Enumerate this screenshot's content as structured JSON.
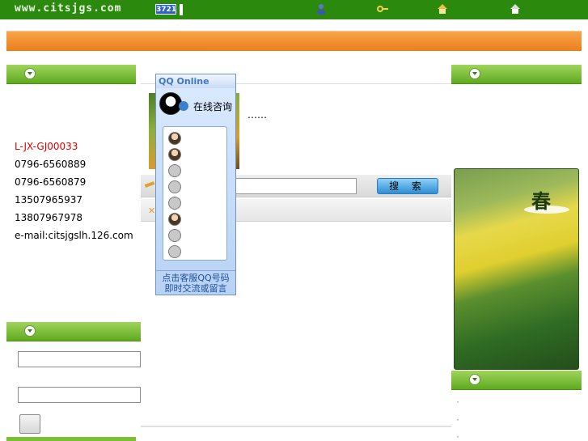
{
  "topbar": {
    "site_url": "www.citsjgs.com",
    "badge": "3721",
    "tagline": "",
    "links": [
      {
        "label": "",
        "icon": "user-icon"
      },
      {
        "label": "",
        "icon": "key-icon"
      },
      {
        "label": "",
        "icon": "house-icon"
      },
      {
        "label": "",
        "icon": "home-icon"
      }
    ]
  },
  "banner": {
    "text": ""
  },
  "left": {
    "contact_head": "",
    "contact": {
      "company_prefix": "",
      "company_red": "",
      "license_label": "",
      "license_value": "L-JX-GJ00033",
      "phone_label": "",
      "phone1": "0796-6560889",
      "phone2": "0796-6560879",
      "mobile_label": "",
      "mobile1": "13507965937",
      "mobile2": "13807967978",
      "email": "e-mail:citsjgslh.126.com",
      "address": ""
    },
    "login_head": "",
    "login": {
      "user_label": "",
      "pass_label": "",
      "submit_label": "",
      "register_label": ""
    }
  },
  "center": {
    "section_title": "",
    "description_lines": [
      "",
      "",
      "……"
    ],
    "search_button": "搜 索"
  },
  "qq": {
    "title": "QQ Online",
    "online_label": "在线咨询",
    "items": [
      "",
      "",
      "",
      "",
      "",
      "",
      "",
      ""
    ],
    "footer_line1": "点击客服QQ号码",
    "footer_line2": "即时交流或留言"
  },
  "right": {
    "head1": "",
    "text_big1": "",
    "text_big2": "",
    "image_caption": "春",
    "head2": "",
    "links": [
      "",
      "",
      ""
    ]
  },
  "colors": {
    "topbar": "#2b8a0e",
    "banner": "#ec7f1b",
    "section_head": "#7bbf36",
    "accent_red": "#e00000"
  }
}
